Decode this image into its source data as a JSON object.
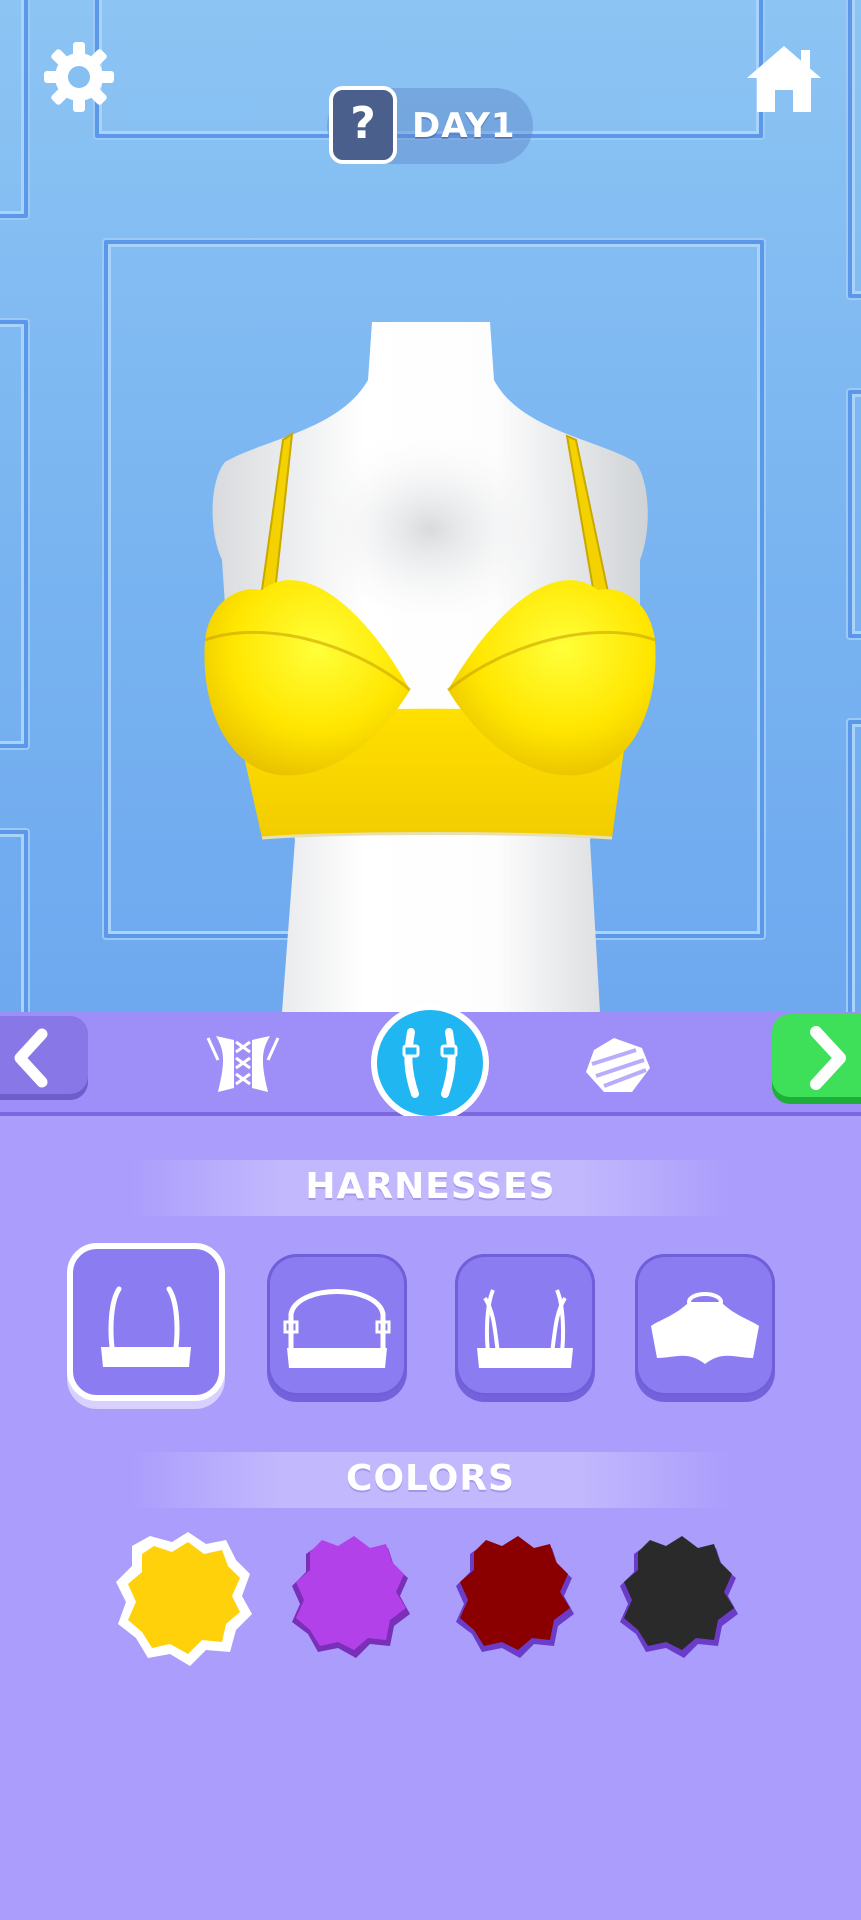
{
  "hud": {
    "settings_icon": "gear-icon",
    "home_icon": "home-icon",
    "help_symbol": "?",
    "day_label": "DAY1"
  },
  "tabs": {
    "items": [
      {
        "icon": "corset-icon",
        "active": false
      },
      {
        "icon": "harness-straps-icon",
        "active": true
      },
      {
        "icon": "fabric-pattern-icon",
        "active": false
      }
    ],
    "prev_icon": "chevron-left-icon",
    "next_icon": "chevron-right-icon"
  },
  "harnesses": {
    "title": "HARNESSES",
    "options": [
      {
        "icon": "thin-straps-icon",
        "selected": true
      },
      {
        "icon": "halter-strap-icon",
        "selected": false
      },
      {
        "icon": "double-straps-icon",
        "selected": false
      },
      {
        "icon": "high-neck-icon",
        "selected": false
      }
    ]
  },
  "colors": {
    "title": "COLORS",
    "swatches": [
      {
        "name": "yellow",
        "color": "#ffd10a",
        "selected": true
      },
      {
        "name": "purple",
        "color": "#b341ea",
        "selected": false
      },
      {
        "name": "dark-red",
        "color": "#8a0000",
        "selected": false
      },
      {
        "name": "black",
        "color": "#2a2a2a",
        "selected": false
      }
    ]
  },
  "theme": {
    "wall": "#7ab5f1",
    "tab_bar": "#9e8ef8",
    "panel": "#ab9dfc",
    "accent_blue": "#1fb6f2",
    "next_green": "#3ee05a",
    "garment": "#ffe600"
  }
}
